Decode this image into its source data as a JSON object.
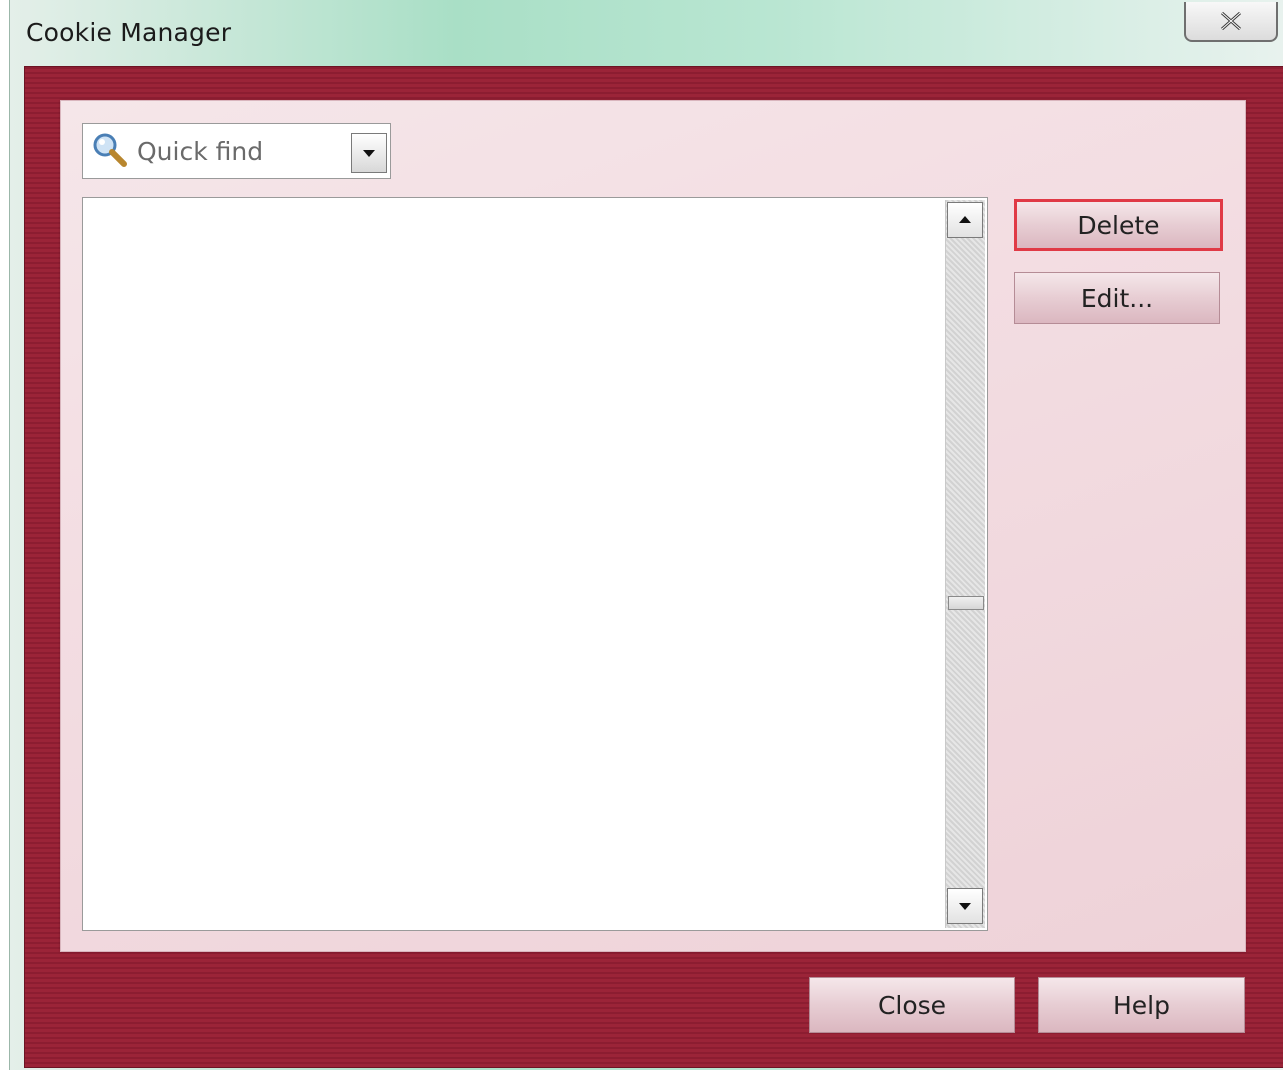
{
  "window": {
    "title": "Cookie Manager"
  },
  "search": {
    "placeholder": "Quick find",
    "icon": "magnifier-icon"
  },
  "actions": {
    "delete_label": "Delete",
    "edit_label": "Edit..."
  },
  "footer": {
    "close_label": "Close",
    "help_label": "Help"
  },
  "colors": {
    "title_bar": "#b9e6d2",
    "frame": "#9b2438",
    "panel": "#f3dde2",
    "focus_border": "#e03a46"
  }
}
